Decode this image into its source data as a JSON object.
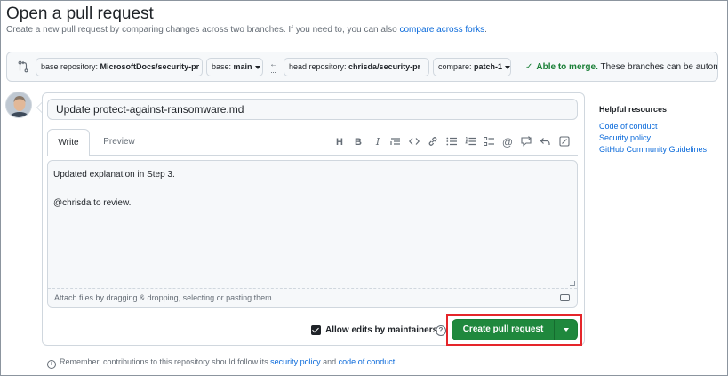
{
  "page": {
    "title": "Open a pull request",
    "subtitle": "Create a new pull request by comparing changes across two branches. If you need to, you can also ",
    "subtitle_link": "compare across forks",
    "subtitle_end": "."
  },
  "compare": {
    "base_repo_label": "base repository: ",
    "base_repo_value": "MicrosoftDocs/security-pr",
    "base_label": "base: ",
    "base_value": "main",
    "head_repo_label": "head repository: ",
    "head_repo_value": "chrisda/security-pr",
    "compare_label": "compare: ",
    "compare_value": "patch-1",
    "merge_ok": "Able to merge.",
    "merge_rest": " These branches can be automatically merged."
  },
  "composer": {
    "title_value": "Update protect-against-ransomware.md",
    "tabs": [
      "Write",
      "Preview"
    ],
    "toolbar": [
      {
        "name": "heading-icon",
        "glyph": "H"
      },
      {
        "name": "bold-icon",
        "glyph": "B"
      },
      {
        "name": "italic-icon",
        "glyph": "I"
      },
      {
        "name": "quote-icon",
        "glyph": "quote"
      },
      {
        "name": "code-icon",
        "glyph": "<>"
      },
      {
        "name": "link-icon",
        "glyph": "link"
      },
      {
        "name": "bulleted-list-icon",
        "glyph": "ul"
      },
      {
        "name": "numbered-list-icon",
        "glyph": "ol"
      },
      {
        "name": "task-list-icon",
        "glyph": "task"
      },
      {
        "name": "mention-icon",
        "glyph": "@"
      },
      {
        "name": "reference-icon",
        "glyph": "ref"
      },
      {
        "name": "reply-icon",
        "glyph": "reply"
      },
      {
        "name": "fullscreen-icon",
        "glyph": "full"
      }
    ],
    "body_text": "Updated explanation in Step 3.\n\n@chrisda to review.",
    "attach_text": "Attach files by dragging & dropping, selecting or pasting them.",
    "allow_edits_label": "Allow edits by maintainers",
    "allow_edits_checked": true,
    "create_button_label": "Create pull request"
  },
  "footer": {
    "prefix": "Remember, contributions to this repository should follow its ",
    "link1": "security policy",
    "mid": " and ",
    "link2": "code of conduct",
    "end": "."
  },
  "resources": {
    "heading": "Helpful resources",
    "links": [
      "Code of conduct",
      "Security policy",
      "GitHub Community Guidelines"
    ]
  },
  "colors": {
    "primary_button": "#1f883d",
    "link": "#0969da",
    "success": "#1a7f37",
    "highlight_box": "#e5252a"
  }
}
